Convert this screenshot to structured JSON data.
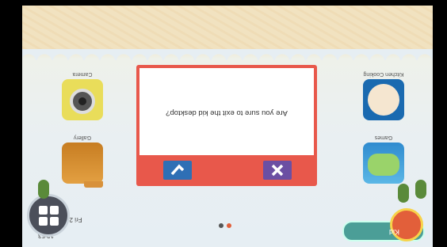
{
  "dialog": {
    "message": "Are you sure to exit the kid desktop?",
    "confirm_icon": "check-icon",
    "cancel_icon": "close-icon",
    "confirm_color": "#2e6fb5",
    "cancel_color": "#6b4fa3"
  },
  "apps": [
    {
      "label": "Camera",
      "icon": "camera-icon"
    },
    {
      "label": "Gallery",
      "icon": "folder-icon"
    },
    {
      "label": "Games",
      "icon": "gamepad-icon"
    },
    {
      "label": "Kitchen Cooking",
      "icon": "chef-icon"
    }
  ],
  "dock": {
    "kid_label": "Kid",
    "time": "12:53",
    "date": "Fri 2, May 2018"
  },
  "colors": {
    "dialog_bg": "#e8584b",
    "sand": "#f1e2c0"
  }
}
